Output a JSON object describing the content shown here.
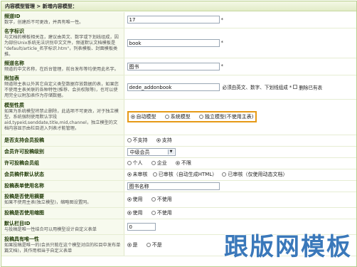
{
  "header": {
    "title": "内容模型管理 > 新增内容模型："
  },
  "rows": {
    "channel_id": {
      "label": "频道ID",
      "desc": "数字，创建后不可更改，并具有唯一性。",
      "value": "17",
      "star": "*"
    },
    "name_id": {
      "label": "名字标识",
      "desc": "与文档的模板相关连，建议由英文、数字或下划线组成，因为部份Unix系统无法识别中文文件，频道默认文档模板是 \"default/article_名字标识.htm\"，列表模板、封面模板类推。",
      "value": "book",
      "star": "*"
    },
    "channel_name": {
      "label": "频道名称",
      "desc": "频道的中文名称，在后台管理，前台发布等均使用此名字。",
      "value": "图书",
      "star": "*"
    },
    "addon_table": {
      "label": "附加表",
      "desc": "频道除主表以外其它自定义类型数据存放数据的表，如果您不使用主表关联的各种特性(推荐、会员权限等)，也可以使用完全以附加表作为存储数据。",
      "value": "dede_addonbook",
      "note": "必须由英文、数字、下划线组成 *",
      "delete_label": "删除已有表"
    },
    "model_type": {
      "label": "模型性质",
      "desc": "如果为系统模型将禁止删除，此选项不可更改，对于独立模型，系统强制使用默认字段aid,typeid,senddate,title,mid,channel，独立模型的文档内容显示由栏目进入列表才能管理。",
      "options": [
        "自动模型",
        "系统模型",
        "独立模型(不使用主表)"
      ],
      "selected": 0
    },
    "member_submit": {
      "label": "是否支持会员投稿",
      "options": [
        "不支持",
        "支持"
      ],
      "selected": 1
    },
    "member_level": {
      "label": "会员许可投稿级别",
      "value": "中级会员"
    },
    "member_group": {
      "label": "许可投稿会员组",
      "options": [
        "个人",
        "企业",
        "不限"
      ],
      "selected": 2
    },
    "member_status": {
      "label": "会员稿件默认状态",
      "options": [
        "未审核",
        "已审核（自动生成HTML）",
        "已审核（仅使用动态文档）"
      ],
      "selected": 0
    },
    "submit_form_name": {
      "label": "投稿表单使用名称",
      "value": "图书名称"
    },
    "use_summary": {
      "label": "投稿是否使用摘要",
      "desc": "如果不使用主表(独立模型)，缩略图设置同。",
      "options": [
        "使用",
        "不使用"
      ],
      "selected": 0
    },
    "use_thumb": {
      "label": "投稿是否使用缩图",
      "options": [
        "使用",
        "不使用"
      ],
      "selected": 0
    },
    "default_column": {
      "label": "默认栏目ID",
      "desc": "与投稿是唯一性结合可以用模型设计自定义表单",
      "value": "0"
    },
    "unique": {
      "label": "投稿具有唯一性",
      "desc": "如果投稿是唯一的(会员只能在这个模型对应的栏目中发布单篇文档)，其作用相当于自定义表单",
      "options": [
        "是",
        "不是"
      ],
      "selected": 0
    }
  },
  "watermark": "跟版网模板"
}
